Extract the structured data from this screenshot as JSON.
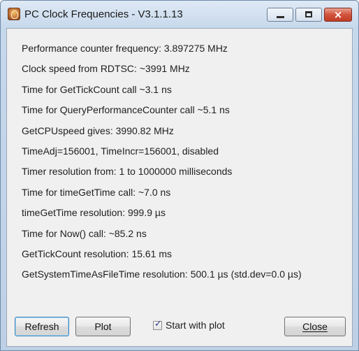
{
  "window": {
    "title": "PC Clock Frequencies - V3.1.1.13",
    "app_icon": "clock-app-icon",
    "controls": {
      "minimize": "minimize-icon",
      "maximize": "maximize-icon",
      "close": "×"
    }
  },
  "info_lines": [
    "Performance counter frequency: 3.897275 MHz",
    "Clock speed from RDTSC: ~3991 MHz",
    "Time for GetTickCount call ~3.1 ns",
    "Time for QueryPerformanceCounter call ~5.1 ns",
    "GetCPUspeed gives: 3990.82 MHz",
    "TimeAdj=156001, TimeIncr=156001, disabled",
    "Timer resolution from: 1 to 1000000 milliseconds",
    "Time for timeGetTime call: ~7.0 ns",
    "timeGetTime resolution: 999.9 µs",
    "Time for Now() call: ~85.2 ns",
    "GetTickCount resolution: 15.61 ms",
    "GetSystemTimeAsFileTime resolution: 500.1 µs  (std.dev=0.0 µs)"
  ],
  "buttons": {
    "refresh": "Refresh",
    "plot": "Plot",
    "close": "Close"
  },
  "start_with_plot": {
    "label": "Start with plot",
    "checked": true,
    "check_glyph": "✓"
  },
  "colors": {
    "titlebar": "#c6d8ec",
    "close_button": "#d2533c",
    "client_bg": "#f0f0f0",
    "default_button_border": "#3c7fb1"
  }
}
